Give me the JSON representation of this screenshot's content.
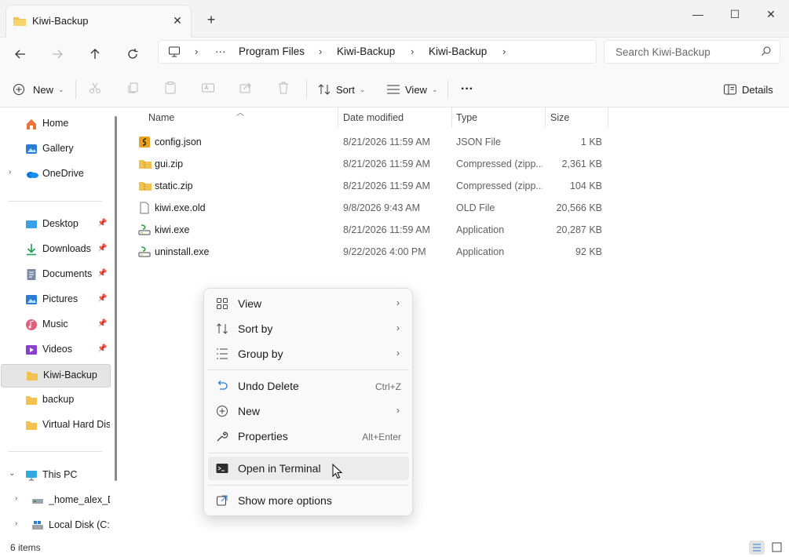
{
  "window": {
    "tab_title": "Kiwi-Backup",
    "close_tab": "✕",
    "new_tab": "+",
    "minimize": "—",
    "maximize": "☐",
    "close": "✕"
  },
  "address": {
    "breadcrumbs": [
      "Program Files",
      "Kiwi-Backup",
      "Kiwi-Backup"
    ],
    "ellipsis": "···",
    "search_placeholder": "Search Kiwi-Backup"
  },
  "toolbar": {
    "new_label": "New",
    "sort_label": "Sort",
    "view_label": "View",
    "more_label": "···",
    "details_label": "Details"
  },
  "sidebar": {
    "items": [
      {
        "label": "Home",
        "icon": "home-icon"
      },
      {
        "label": "Gallery",
        "icon": "gallery-icon"
      },
      {
        "label": "OneDrive",
        "icon": "cloud-icon"
      },
      {
        "label": "Desktop",
        "icon": "desktop-icon"
      },
      {
        "label": "Downloads",
        "icon": "download-icon"
      },
      {
        "label": "Documents",
        "icon": "documents-icon"
      },
      {
        "label": "Pictures",
        "icon": "pictures-icon"
      },
      {
        "label": "Music",
        "icon": "music-icon"
      },
      {
        "label": "Videos",
        "icon": "videos-icon"
      },
      {
        "label": "Kiwi-Backup",
        "icon": "folder-icon"
      },
      {
        "label": "backup",
        "icon": "folder-icon"
      },
      {
        "label": "Virtual Hard Disk",
        "icon": "folder-icon"
      },
      {
        "label": "This PC",
        "icon": "pc-icon"
      },
      {
        "label": "_home_alex_De",
        "icon": "network-drive-icon"
      },
      {
        "label": "Local Disk (C:)",
        "icon": "drive-icon"
      }
    ]
  },
  "columns": {
    "name": "Name",
    "date": "Date modified",
    "type": "Type",
    "size": "Size"
  },
  "files": [
    {
      "name": "config.json",
      "date": "8/21/2026 11:59 AM",
      "type": "JSON File",
      "size": "1 KB"
    },
    {
      "name": "gui.zip",
      "date": "8/21/2026 11:59 AM",
      "type": "Compressed (zipp...",
      "size": "2,361 KB"
    },
    {
      "name": "static.zip",
      "date": "8/21/2026 11:59 AM",
      "type": "Compressed (zipp...",
      "size": "104 KB"
    },
    {
      "name": "kiwi.exe.old",
      "date": "9/8/2026 9:43 AM",
      "type": "OLD File",
      "size": "20,566 KB"
    },
    {
      "name": "kiwi.exe",
      "date": "8/21/2026 11:59 AM",
      "type": "Application",
      "size": "20,287 KB"
    },
    {
      "name": "uninstall.exe",
      "date": "9/22/2026 4:00 PM",
      "type": "Application",
      "size": "92 KB"
    }
  ],
  "context_menu": {
    "view": "View",
    "sort_by": "Sort by",
    "group_by": "Group by",
    "undo_delete": "Undo Delete",
    "undo_shortcut": "Ctrl+Z",
    "new": "New",
    "properties": "Properties",
    "properties_shortcut": "Alt+Enter",
    "open_terminal": "Open in Terminal",
    "show_more": "Show more options"
  },
  "status": {
    "item_count": "6 items"
  },
  "colors": {
    "folder": "#f2c14e",
    "accent": "#0067c0",
    "selected": "#e5e5e5"
  }
}
